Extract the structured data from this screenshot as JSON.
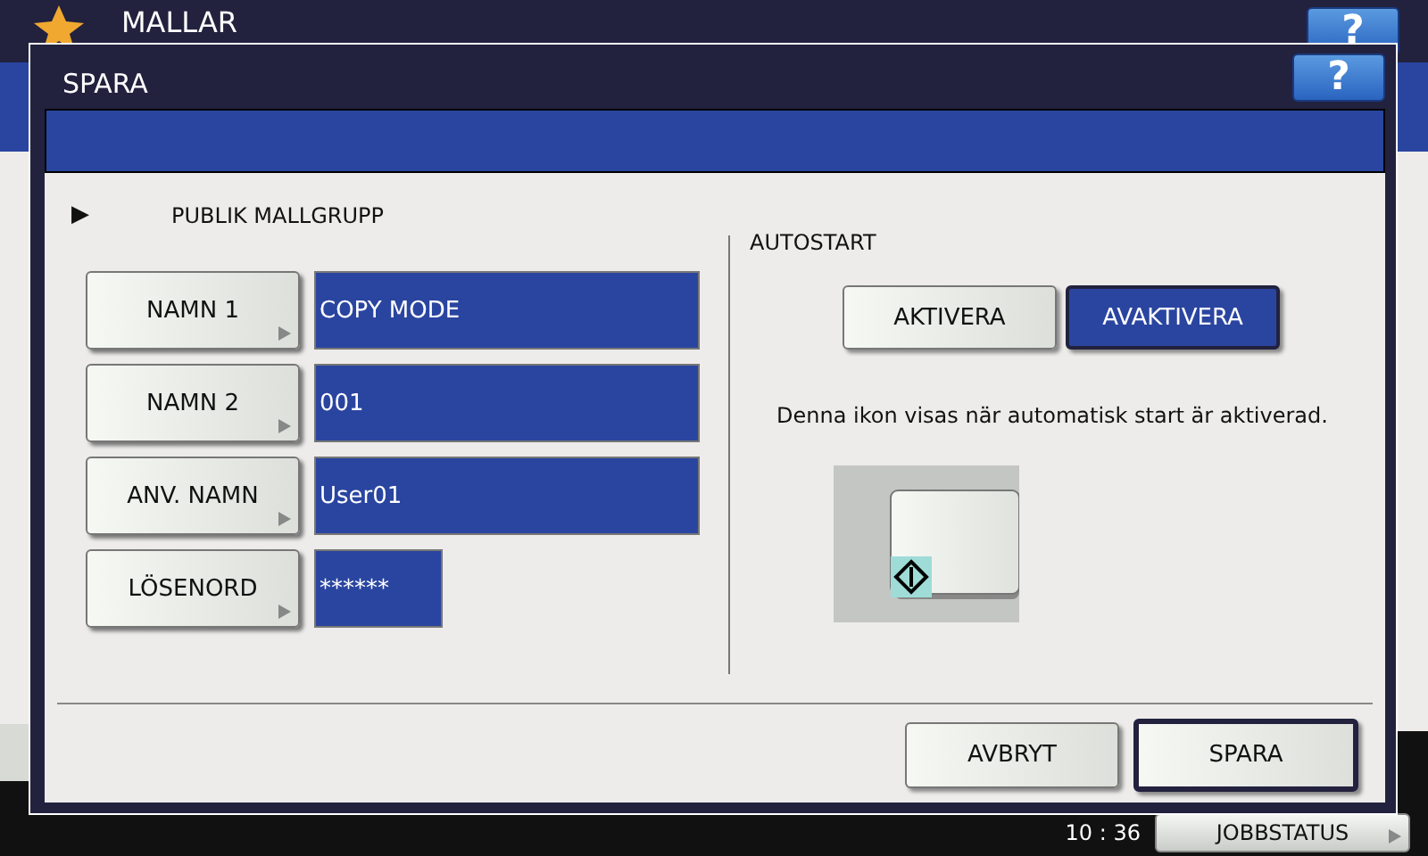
{
  "background": {
    "title": "MALLAR",
    "help": "?",
    "clock": "10 : 36",
    "job_status": "JOBBSTATUS"
  },
  "dialog": {
    "title": "SPARA",
    "help": "?",
    "group_marker": "▶",
    "group": "PUBLIK MALLGRUPP",
    "fields": [
      {
        "label": "NAMN 1",
        "value": "COPY MODE",
        "kind": "text"
      },
      {
        "label": "NAMN 2",
        "value": "001",
        "kind": "text"
      },
      {
        "label": "ANV. NAMN",
        "value": "User01",
        "kind": "text"
      },
      {
        "label": "LÖSENORD",
        "value": "******",
        "kind": "password"
      }
    ],
    "autostart": {
      "title": "AUTOSTART",
      "options": [
        {
          "label": "AKTIVERA",
          "selected": false
        },
        {
          "label": "AVAKTIVERA",
          "selected": true
        }
      ],
      "note": "Denna ikon visas när automatisk start är aktiverad."
    },
    "buttons": [
      {
        "label": "AVBRYT",
        "default": false
      },
      {
        "label": "SPARA",
        "default": true
      }
    ]
  }
}
